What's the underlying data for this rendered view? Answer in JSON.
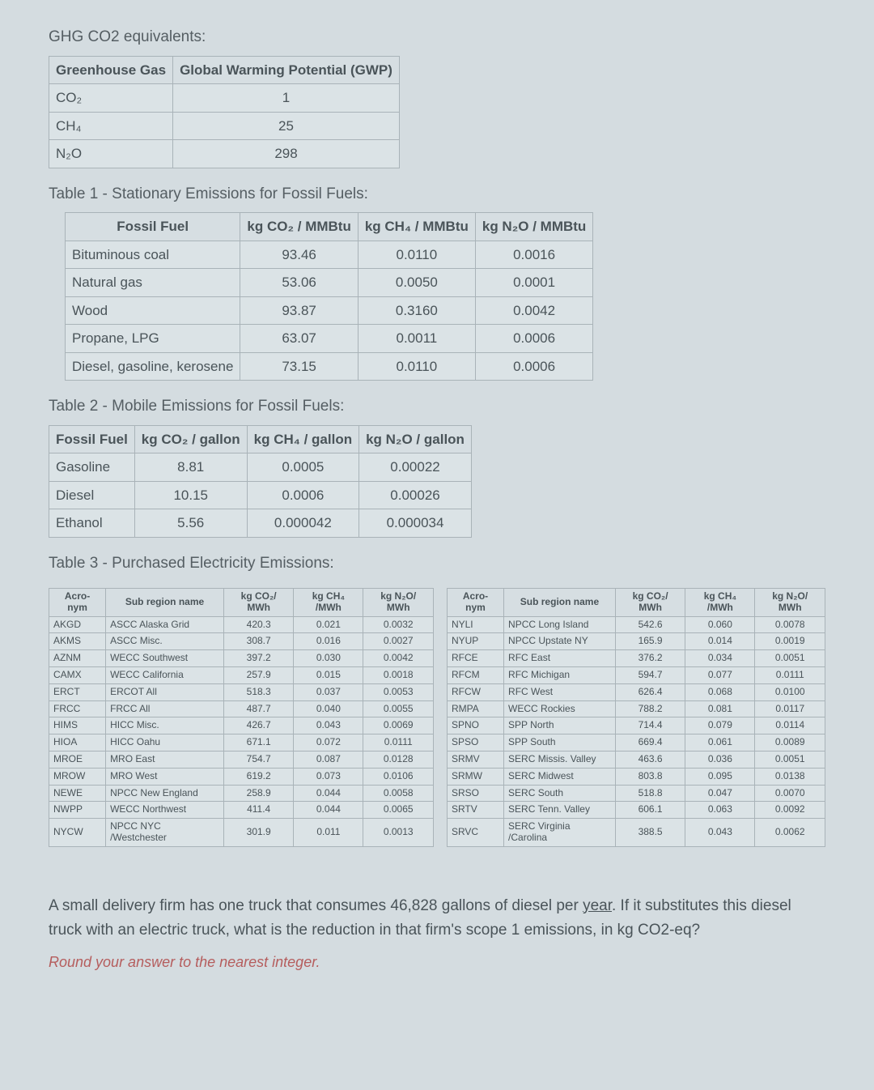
{
  "title_gwp": "GHG CO2 equivalents:",
  "gwp": {
    "headers": [
      "Greenhouse Gas",
      "Global Warming Potential (GWP)"
    ],
    "rows": [
      {
        "gas": "CO₂",
        "gwp": "1"
      },
      {
        "gas": "CH₄",
        "gwp": "25"
      },
      {
        "gas": "N₂O",
        "gwp": "298"
      }
    ]
  },
  "title_t1": "Table 1 - Stationary Emissions for Fossil Fuels:",
  "t1": {
    "headers": [
      "Fossil Fuel",
      "kg CO₂ / MMBtu",
      "kg CH₄ / MMBtu",
      "kg N₂O / MMBtu"
    ],
    "rows": [
      {
        "f": "Bituminous coal",
        "co2": "93.46",
        "ch4": "0.0110",
        "n2o": "0.0016"
      },
      {
        "f": "Natural gas",
        "co2": "53.06",
        "ch4": "0.0050",
        "n2o": "0.0001"
      },
      {
        "f": "Wood",
        "co2": "93.87",
        "ch4": "0.3160",
        "n2o": "0.0042"
      },
      {
        "f": "Propane, LPG",
        "co2": "63.07",
        "ch4": "0.0011",
        "n2o": "0.0006"
      },
      {
        "f": "Diesel, gasoline, kerosene",
        "co2": "73.15",
        "ch4": "0.0110",
        "n2o": "0.0006"
      }
    ]
  },
  "title_t2": "Table 2 - Mobile Emissions for Fossil Fuels:",
  "t2": {
    "headers": [
      "Fossil Fuel",
      "kg CO₂ / gallon",
      "kg CH₄ / gallon",
      "kg N₂O / gallon"
    ],
    "rows": [
      {
        "f": "Gasoline",
        "co2": "8.81",
        "ch4": "0.0005",
        "n2o": "0.00022"
      },
      {
        "f": "Diesel",
        "co2": "10.15",
        "ch4": "0.0006",
        "n2o": "0.00026"
      },
      {
        "f": "Ethanol",
        "co2": "5.56",
        "ch4": "0.000042",
        "n2o": "0.000034"
      }
    ]
  },
  "title_t3": "Table 3 - Purchased Electricity Emissions:",
  "t3": {
    "headers": [
      "Acro- nym",
      "Sub region name",
      "kg CO₂/ MWh",
      "kg CH₄ /MWh",
      "kg N₂O/ MWh"
    ],
    "left": [
      {
        "a": "AKGD",
        "s": "ASCC Alaska Grid",
        "c": "420.3",
        "m": "0.021",
        "n": "0.0032"
      },
      {
        "a": "AKMS",
        "s": "ASCC Misc.",
        "c": "308.7",
        "m": "0.016",
        "n": "0.0027"
      },
      {
        "a": "AZNM",
        "s": "WECC Southwest",
        "c": "397.2",
        "m": "0.030",
        "n": "0.0042"
      },
      {
        "a": "CAMX",
        "s": "WECC California",
        "c": "257.9",
        "m": "0.015",
        "n": "0.0018"
      },
      {
        "a": "ERCT",
        "s": "ERCOT All",
        "c": "518.3",
        "m": "0.037",
        "n": "0.0053"
      },
      {
        "a": "FRCC",
        "s": "FRCC All",
        "c": "487.7",
        "m": "0.040",
        "n": "0.0055"
      },
      {
        "a": "HIMS",
        "s": "HICC Misc.",
        "c": "426.7",
        "m": "0.043",
        "n": "0.0069"
      },
      {
        "a": "HIOA",
        "s": "HICC Oahu",
        "c": "671.1",
        "m": "0.072",
        "n": "0.0111"
      },
      {
        "a": "MROE",
        "s": "MRO East",
        "c": "754.7",
        "m": "0.087",
        "n": "0.0128"
      },
      {
        "a": "MROW",
        "s": "MRO West",
        "c": "619.2",
        "m": "0.073",
        "n": "0.0106"
      },
      {
        "a": "NEWE",
        "s": "NPCC New England",
        "c": "258.9",
        "m": "0.044",
        "n": "0.0058"
      },
      {
        "a": "NWPP",
        "s": "WECC Northwest",
        "c": "411.4",
        "m": "0.044",
        "n": "0.0065"
      },
      {
        "a": "NYCW",
        "s": "NPCC NYC /Westchester",
        "c": "301.9",
        "m": "0.011",
        "n": "0.0013"
      }
    ],
    "right": [
      {
        "a": "NYLI",
        "s": "NPCC Long Island",
        "c": "542.6",
        "m": "0.060",
        "n": "0.0078"
      },
      {
        "a": "NYUP",
        "s": "NPCC Upstate NY",
        "c": "165.9",
        "m": "0.014",
        "n": "0.0019"
      },
      {
        "a": "RFCE",
        "s": "RFC East",
        "c": "376.2",
        "m": "0.034",
        "n": "0.0051"
      },
      {
        "a": "RFCM",
        "s": "RFC Michigan",
        "c": "594.7",
        "m": "0.077",
        "n": "0.0111"
      },
      {
        "a": "RFCW",
        "s": "RFC West",
        "c": "626.4",
        "m": "0.068",
        "n": "0.0100"
      },
      {
        "a": "RMPA",
        "s": "WECC Rockies",
        "c": "788.2",
        "m": "0.081",
        "n": "0.0117"
      },
      {
        "a": "SPNO",
        "s": "SPP North",
        "c": "714.4",
        "m": "0.079",
        "n": "0.0114"
      },
      {
        "a": "SPSO",
        "s": "SPP South",
        "c": "669.4",
        "m": "0.061",
        "n": "0.0089"
      },
      {
        "a": "SRMV",
        "s": "SERC Missis. Valley",
        "c": "463.6",
        "m": "0.036",
        "n": "0.0051"
      },
      {
        "a": "SRMW",
        "s": "SERC Midwest",
        "c": "803.8",
        "m": "0.095",
        "n": "0.0138"
      },
      {
        "a": "SRSO",
        "s": "SERC South",
        "c": "518.8",
        "m": "0.047",
        "n": "0.0070"
      },
      {
        "a": "SRTV",
        "s": "SERC Tenn. Valley",
        "c": "606.1",
        "m": "0.063",
        "n": "0.0092"
      },
      {
        "a": "SRVC",
        "s": "SERC Virginia /Carolina",
        "c": "388.5",
        "m": "0.043",
        "n": "0.0062"
      }
    ]
  },
  "question": {
    "pre": "A small delivery firm has one truck that consumes 46,828 gallons of diesel per ",
    "year": "year",
    "post": ". If it substitutes this diesel truck with an electric truck, what is the reduction in that firm's scope 1 emissions, in kg CO2-eq?",
    "round": "Round your answer to the nearest integer."
  }
}
